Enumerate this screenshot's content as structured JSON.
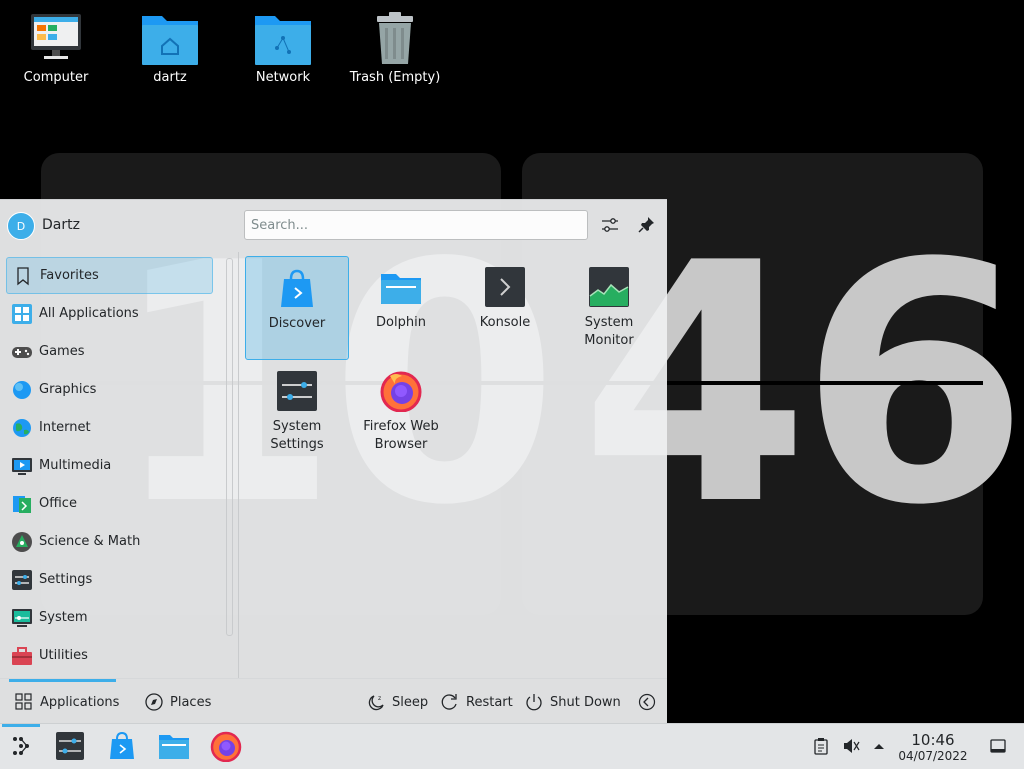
{
  "desktop": {
    "icons": [
      {
        "label": "Computer"
      },
      {
        "label": "dartz"
      },
      {
        "label": "Network"
      },
      {
        "label": "Trash (Empty)"
      }
    ]
  },
  "clock_widget": {
    "hours": "10",
    "minutes": "46"
  },
  "launcher": {
    "user": {
      "name": "Dartz",
      "initial": "D"
    },
    "search_placeholder": "Search...",
    "categories": [
      {
        "label": "Favorites",
        "icon": "bookmark-icon"
      },
      {
        "label": "All Applications",
        "icon": "grid-icon"
      },
      {
        "label": "Games",
        "icon": "gamepad-icon"
      },
      {
        "label": "Graphics",
        "icon": "graphics-icon"
      },
      {
        "label": "Internet",
        "icon": "globe-icon"
      },
      {
        "label": "Multimedia",
        "icon": "multimedia-icon"
      },
      {
        "label": "Office",
        "icon": "office-icon"
      },
      {
        "label": "Science & Math",
        "icon": "science-icon"
      },
      {
        "label": "Settings",
        "icon": "settings-icon"
      },
      {
        "label": "System",
        "icon": "system-icon"
      },
      {
        "label": "Utilities",
        "icon": "toolbox-icon"
      }
    ],
    "favorites": [
      {
        "label": "Discover",
        "icon": "discover-icon",
        "selected": true
      },
      {
        "label": "Dolphin",
        "icon": "dolphin-icon"
      },
      {
        "label": "Konsole",
        "icon": "konsole-icon"
      },
      {
        "label": "System Monitor",
        "icon": "system-monitor-icon"
      },
      {
        "label": "System Settings",
        "icon": "system-settings-icon"
      },
      {
        "label": "Firefox Web Browser",
        "icon": "firefox-icon"
      }
    ],
    "footer": {
      "applications": "Applications",
      "places": "Places",
      "sleep": "Sleep",
      "restart": "Restart",
      "shutdown": "Shut Down"
    }
  },
  "panel": {
    "time": "10:46",
    "date": "04/07/2022",
    "tasks": [
      "launcher-icon",
      "system-settings-icon",
      "discover-icon",
      "dolphin-icon",
      "firefox-icon"
    ]
  },
  "colors": {
    "accent": "#3daee9",
    "panel": "#e3e5e7",
    "launcher_bg": "#eff0f1"
  }
}
